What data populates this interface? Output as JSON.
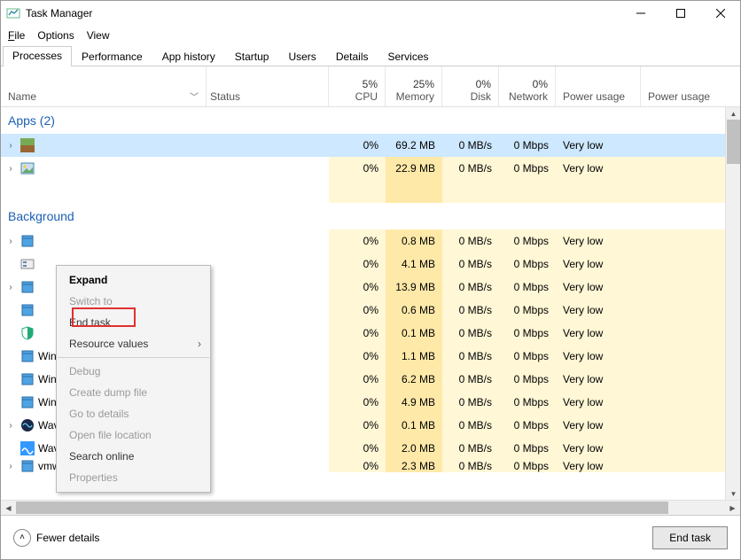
{
  "title": "Task Manager",
  "menus": {
    "file": "File",
    "options": "Options",
    "view": "View"
  },
  "tabs": [
    "Processes",
    "Performance",
    "App history",
    "Startup",
    "Users",
    "Details",
    "Services"
  ],
  "active_tab": 0,
  "columns": {
    "name": "Name",
    "status": "Status",
    "cpu": {
      "pct": "5%",
      "label": "CPU"
    },
    "mem": {
      "pct": "25%",
      "label": "Memory"
    },
    "disk": {
      "pct": "0%",
      "label": "Disk"
    },
    "net": {
      "pct": "0%",
      "label": "Network"
    },
    "power": "Power usage",
    "power2": "Power usage"
  },
  "groups": {
    "apps": {
      "label": "Apps (2)"
    },
    "background": {
      "label": "Background"
    }
  },
  "rows": [
    {
      "chev": true,
      "icon": "mc",
      "name": "",
      "cpu": "0%",
      "mem": "69.2 MB",
      "disk": "0 MB/s",
      "net": "0 Mbps",
      "power": "Very low",
      "selected": true
    },
    {
      "chev": true,
      "icon": "pic",
      "name": "",
      "cpu": "0%",
      "mem": "22.9 MB",
      "disk": "0 MB/s",
      "net": "0 Mbps",
      "power": "Very low"
    },
    {
      "blank": true
    },
    {
      "chev": true,
      "icon": "svc",
      "name": "",
      "cpu": "0%",
      "mem": "0.8 MB",
      "disk": "0 MB/s",
      "net": "0 Mbps",
      "power": "Very low"
    },
    {
      "chev": false,
      "icon": "cfg",
      "name": "",
      "cpu": "0%",
      "mem": "4.1 MB",
      "disk": "0 MB/s",
      "net": "0 Mbps",
      "power": "Very low"
    },
    {
      "chev": true,
      "icon": "svc",
      "name": "",
      "cpu": "0%",
      "mem": "13.9 MB",
      "disk": "0 MB/s",
      "net": "0 Mbps",
      "power": "Very low"
    },
    {
      "chev": false,
      "icon": "svc",
      "name": "",
      "cpu": "0%",
      "mem": "0.6 MB",
      "disk": "0 MB/s",
      "net": "0 Mbps",
      "power": "Very low"
    },
    {
      "chev": false,
      "icon": "shld",
      "name": "",
      "cpu": "0%",
      "mem": "0.1 MB",
      "disk": "0 MB/s",
      "net": "0 Mbps",
      "power": "Very low"
    },
    {
      "chev": false,
      "icon": "svc",
      "name": "Windows Security Health Service",
      "cpu": "0%",
      "mem": "1.1 MB",
      "disk": "0 MB/s",
      "net": "0 Mbps",
      "power": "Very low"
    },
    {
      "chev": false,
      "icon": "svc",
      "name": "Windows Defender SmartScreen",
      "cpu": "0%",
      "mem": "6.2 MB",
      "disk": "0 MB/s",
      "net": "0 Mbps",
      "power": "Very low"
    },
    {
      "chev": false,
      "icon": "svc",
      "name": "Windows Audio Device Graph Is...",
      "cpu": "0%",
      "mem": "4.9 MB",
      "disk": "0 MB/s",
      "net": "0 Mbps",
      "power": "Very low"
    },
    {
      "chev": true,
      "icon": "wav",
      "name": "WavesSysSvc Service Application",
      "cpu": "0%",
      "mem": "0.1 MB",
      "disk": "0 MB/s",
      "net": "0 Mbps",
      "power": "Very low"
    },
    {
      "chev": false,
      "icon": "wvs",
      "name": "Waves MaxxAudio Service Appli...",
      "cpu": "0%",
      "mem": "2.0 MB",
      "disk": "0 MB/s",
      "net": "0 Mbps",
      "power": "Very low"
    },
    {
      "chev": true,
      "icon": "svc",
      "name": "vmware-hostd (32 bit)",
      "cpu": "0%",
      "mem": "2.3 MB",
      "disk": "0 MB/s",
      "net": "0 Mbps",
      "power": "Very low",
      "partial": true
    }
  ],
  "context_menu": {
    "expand": "Expand",
    "switch_to": "Switch to",
    "end_task": "End task",
    "resource_values": "Resource values",
    "debug": "Debug",
    "create_dump": "Create dump file",
    "go_to_details": "Go to details",
    "open_file_loc": "Open file location",
    "search_online": "Search online",
    "properties": "Properties"
  },
  "footer": {
    "fewer": "Fewer details",
    "end_task": "End task"
  }
}
